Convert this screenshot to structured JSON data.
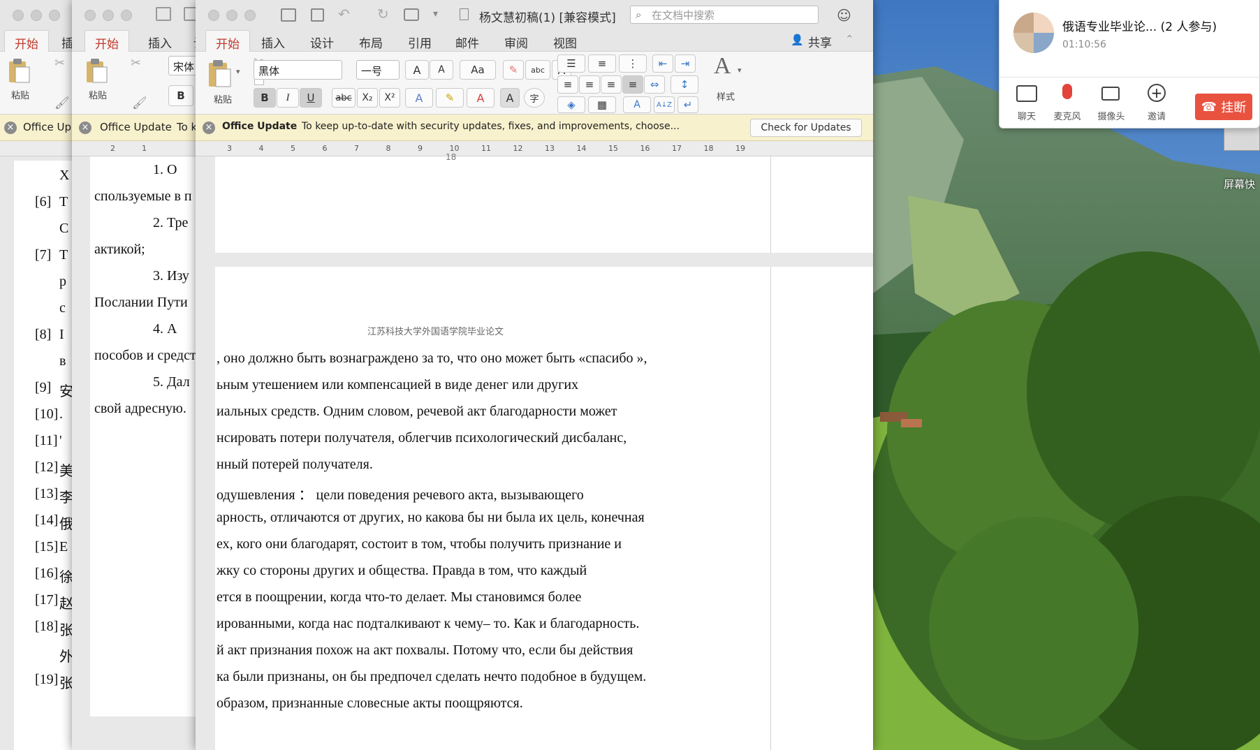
{
  "desktop": {
    "side_label": "屏幕快"
  },
  "win1": {
    "tab_home": "开始",
    "tab_partial": "插",
    "paste_label": "粘贴",
    "office_update_partial": "Office Up",
    "ref_lines": [
      {
        "num": "",
        "text": "X"
      },
      {
        "num": "[6]",
        "text": "T"
      },
      {
        "num": "",
        "text": "C"
      },
      {
        "num": "[7]",
        "text": "T"
      },
      {
        "num": "",
        "text": "р"
      },
      {
        "num": "",
        "text": "с"
      },
      {
        "num": "[8]",
        "text": "I"
      },
      {
        "num": "",
        "text": "в"
      },
      {
        "num": "[9]",
        "text": "安"
      },
      {
        "num": "[10]",
        "text": "."
      },
      {
        "num": "[11]",
        "text": "'"
      },
      {
        "num": "[12]",
        "text": "美"
      },
      {
        "num": "[13]",
        "text": "李"
      },
      {
        "num": "[14]",
        "text": "俄"
      },
      {
        "num": "[15]",
        "text": "E"
      },
      {
        "num": "[16]",
        "text": "徐"
      },
      {
        "num": "[17]",
        "text": "赵"
      },
      {
        "num": "[18]",
        "text": "张"
      },
      {
        "num": "",
        "text": "外"
      },
      {
        "num": "[19]",
        "text": "张"
      }
    ]
  },
  "win2": {
    "tab_home": "开始",
    "tab_insert": "插入",
    "tab_partial": "设",
    "paste_label": "粘贴",
    "font_name": "宋体",
    "bold": "B",
    "office_update": "Office Update",
    "office_update_partial": "To k",
    "page_lines": [
      "1.   O",
      "спользуемые в п",
      "2.  Тре",
      "актикой;",
      "3. Изу",
      "Послании Пути",
      "4.   А",
      "пособов и средст",
      "5. Дал",
      "свой адресную."
    ]
  },
  "win3": {
    "title": "杨文慧初稿(1) [兼容模式]",
    "search_placeholder": "在文档中搜索",
    "tabs": [
      "开始",
      "插入",
      "设计",
      "布局",
      "引用",
      "邮件",
      "审阅",
      "视图"
    ],
    "share": "共享",
    "paste": "粘贴",
    "font_name": "黑体",
    "font_size": "一号",
    "styles_label": "样式",
    "format_buttons": {
      "bold": "B",
      "italic": "I",
      "underline": "U",
      "strike": "abc",
      "subscript": "X₂",
      "superscript": "X²",
      "char_border": "A",
      "phonetic": "字"
    },
    "ribbon_glyphs": {
      "grow": "A",
      "shrink": "A",
      "change_case": "Aa",
      "abc": "abc",
      "text_effect": "A",
      "highlight": "✎",
      "font_color": "A",
      "sort": "A↓Z"
    },
    "msg_title": "Office Update",
    "msg_text": "To keep up-to-date with security updates, fixes, and improvements, choose...",
    "check_updates": "Check for Updates",
    "ruler_numbers": [
      "3",
      "4",
      "5",
      "6",
      "7",
      "8",
      "9",
      "10",
      "11",
      "12",
      "13",
      "14",
      "15",
      "16",
      "17",
      "18",
      "19"
    ],
    "prev_page_num": "18",
    "header_text": "江苏科技大学外国语学院毕业论文",
    "paragraph_lines": [
      ", оно должно быть вознаграждено за то, что оно может быть «спасибо »,",
      "ьным   утешением   или   компенсацией   в   виде   денег   или   других",
      "иальных  средств.  Одним  словом,  речевой  акт  благодарности  может",
      "нсировать  потери  получателя,  облегчив  психологический  дисбаланс,",
      "нный потерей получателя.",
      "одушевления  ：   цели   поведения   речевого   акта,   вызывающего",
      "арность, отличаются от других, но какова бы ни была их цель, конечная",
      "ех, кого они благодарят, состоит в том, чтобы получить признание и",
      "жку  со  стороны  других  и  общества.  Правда  в  том,  что  каждый",
      "ется   в   поощрении,   когда   что-то   делает.   Мы   становимся   более",
      "ированными, когда нас подталкивают к чему– то. Как и благодарность.",
      "й акт признания похож на акт похвалы. Потому что, если бы действия",
      "ка были признаны, он бы предпочел сделать нечто подобное в будущем.",
      " образом, признанные словесные акты поощряются."
    ]
  },
  "meeting": {
    "title": "俄语专业毕业论...  (2 人参与)",
    "elapsed": "01:10:56",
    "tools": [
      "聊天",
      "麦克风",
      "摄像头",
      "邀请"
    ],
    "hangup": "挂断",
    "mic_color": "#e2433b",
    "hangup_color": "#e8523f"
  }
}
